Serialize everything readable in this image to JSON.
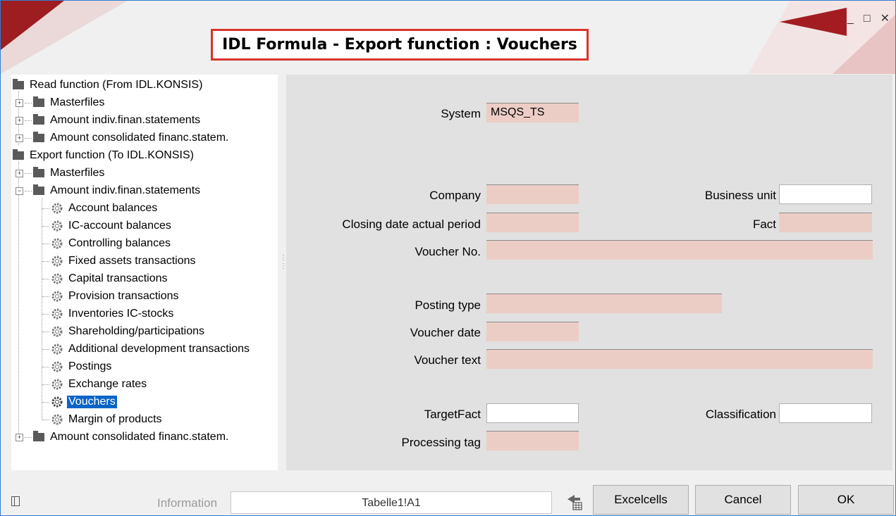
{
  "window": {
    "title": "IDL Formula - Export function : Vouchers",
    "controls": {
      "minimize": "_",
      "maximize": "□",
      "close": "✕"
    }
  },
  "tree": {
    "items": [
      {
        "label": "Read function (From IDL.KONSIS)",
        "kind": "folder",
        "level": 0
      },
      {
        "label": "Masterfiles",
        "kind": "folder",
        "level": 1,
        "expander": "+"
      },
      {
        "label": "Amount indiv.finan.statements",
        "kind": "folder",
        "level": 1,
        "expander": "+"
      },
      {
        "label": "Amount consolidated financ.statem.",
        "kind": "folder",
        "level": 1,
        "expander": "+"
      },
      {
        "label": "Export function (To IDL.KONSIS)",
        "kind": "folder",
        "level": 0
      },
      {
        "label": "Masterfiles",
        "kind": "folder",
        "level": 1,
        "expander": "+"
      },
      {
        "label": "Amount indiv.finan.statements",
        "kind": "folder",
        "level": 1,
        "expander": "−"
      },
      {
        "label": "Account balances",
        "kind": "gear",
        "level": 2
      },
      {
        "label": "IC-account balances",
        "kind": "gear",
        "level": 2
      },
      {
        "label": "Controlling balances",
        "kind": "gear",
        "level": 2
      },
      {
        "label": "Fixed assets transactions",
        "kind": "gear",
        "level": 2
      },
      {
        "label": "Capital transactions",
        "kind": "gear",
        "level": 2
      },
      {
        "label": "Provision transactions",
        "kind": "gear",
        "level": 2
      },
      {
        "label": "Inventories IC-stocks",
        "kind": "gear",
        "level": 2
      },
      {
        "label": "Shareholding/participations",
        "kind": "gear",
        "level": 2
      },
      {
        "label": "Additional development transactions",
        "kind": "gear",
        "level": 2
      },
      {
        "label": "Postings",
        "kind": "gear",
        "level": 2
      },
      {
        "label": "Exchange rates",
        "kind": "gear",
        "level": 2
      },
      {
        "label": "Vouchers",
        "kind": "gear",
        "level": 2,
        "selected": true
      },
      {
        "label": "Margin of products",
        "kind": "gear",
        "level": 2
      },
      {
        "label": "Amount consolidated financ.statem.",
        "kind": "folder",
        "level": 1,
        "expander": "+"
      }
    ]
  },
  "form": {
    "system": {
      "label": "System",
      "value": "MSQS_TS"
    },
    "company": {
      "label": "Company",
      "value": ""
    },
    "business_unit": {
      "label": "Business unit",
      "value": ""
    },
    "closing_date": {
      "label": "Closing date actual period",
      "value": ""
    },
    "fact": {
      "label": "Fact",
      "value": ""
    },
    "voucher_no": {
      "label": "Voucher No.",
      "value": ""
    },
    "posting_type": {
      "label": "Posting type",
      "value": ""
    },
    "voucher_date": {
      "label": "Voucher date",
      "value": ""
    },
    "voucher_text": {
      "label": "Voucher text",
      "value": ""
    },
    "target_fact": {
      "label": "TargetFact",
      "value": ""
    },
    "classification": {
      "label": "Classification",
      "value": ""
    },
    "processing_tag": {
      "label": "Processing tag",
      "value": ""
    }
  },
  "statusbar": {
    "information_label": "Information",
    "information_value": "Tabelle1!A1",
    "excelcells_label": "Excelcells",
    "cancel_label": "Cancel",
    "ok_label": "OK"
  },
  "colors": {
    "accent_red": "#d9342b",
    "field_pink": "#eccdc6",
    "selection_blue": "#0a64c8",
    "window_border": "#2f7fd0"
  },
  "icons": [
    "folder-icon",
    "gear-icon",
    "expand-icon",
    "collapse-icon",
    "window-minimize-icon",
    "window-maximize-icon",
    "window-close-icon",
    "panel-toggle-icon",
    "excel-tool-icon"
  ]
}
